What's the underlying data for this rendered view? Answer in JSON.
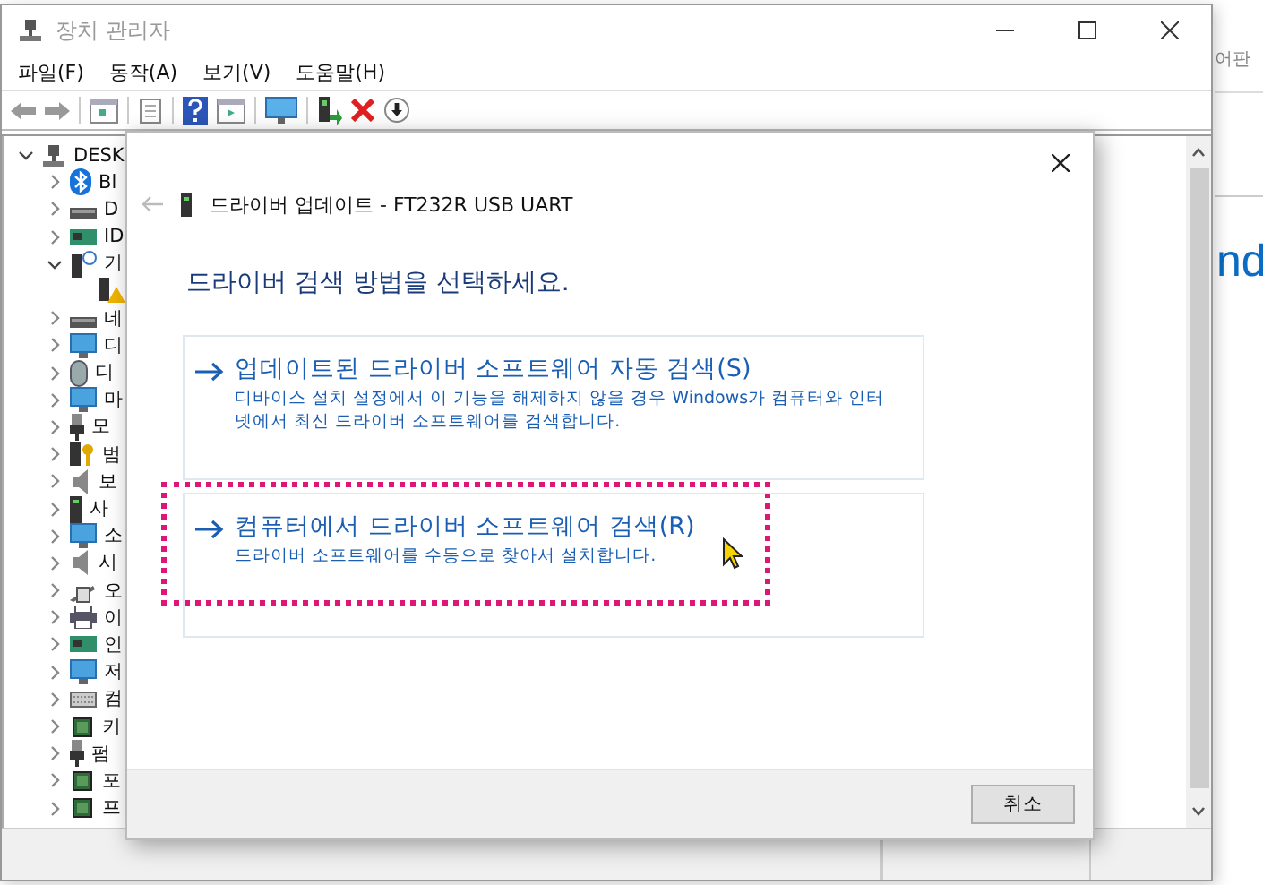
{
  "window": {
    "title": "장치 관리자"
  },
  "menu": [
    "파일(F)",
    "동작(A)",
    "보기(V)",
    "도움말(H)"
  ],
  "tree": [
    {
      "label": "DESK",
      "expanded": true,
      "children": [
        {
          "label": "Bl",
          "expanded": false
        },
        {
          "label": "D",
          "expanded": false
        },
        {
          "label": "ID",
          "expanded": false
        },
        {
          "label": "기",
          "expanded": true,
          "children": [
            {
              "warning": true
            }
          ]
        },
        {
          "label": "네",
          "expanded": false
        },
        {
          "label": "디",
          "expanded": false
        },
        {
          "label": "디",
          "expanded": false
        },
        {
          "label": "마",
          "expanded": false
        },
        {
          "label": "모",
          "expanded": false
        },
        {
          "label": "범",
          "expanded": false
        },
        {
          "label": "보",
          "expanded": false
        },
        {
          "label": "사",
          "expanded": false
        },
        {
          "label": "소",
          "expanded": false
        },
        {
          "label": "시",
          "expanded": false
        },
        {
          "label": "오",
          "expanded": false
        },
        {
          "label": "이",
          "expanded": false
        },
        {
          "label": "인",
          "expanded": false
        },
        {
          "label": "저",
          "expanded": false
        },
        {
          "label": "컴",
          "expanded": false
        },
        {
          "label": "키",
          "expanded": false
        },
        {
          "label": "펌",
          "expanded": false
        },
        {
          "label": "포",
          "expanded": false
        },
        {
          "label": "프",
          "expanded": false
        }
      ]
    }
  ],
  "dialog": {
    "title": "드라이버 업데이트 - FT232R USB UART",
    "heading": "드라이버 검색 방법을 선택하세요.",
    "options": [
      {
        "title": "업데이트된 드라이버 소프트웨어 자동 검색(S)",
        "description": "디바이스 설치 설정에서 이 기능을 해제하지 않을 경우 Windows가 컴퓨터와 인터넷에서 최신 드라이버 소프트웨어를 검색합니다.",
        "highlighted": false
      },
      {
        "title": "컴퓨터에서 드라이버 소프트웨어 검색(R)",
        "description": "드라이버 소프트웨어를 수동으로 찾아서 설치합니다.",
        "highlighted": true
      }
    ],
    "button": "취소"
  },
  "background_window": {
    "side_text": "어판",
    "big_text": "nd"
  }
}
